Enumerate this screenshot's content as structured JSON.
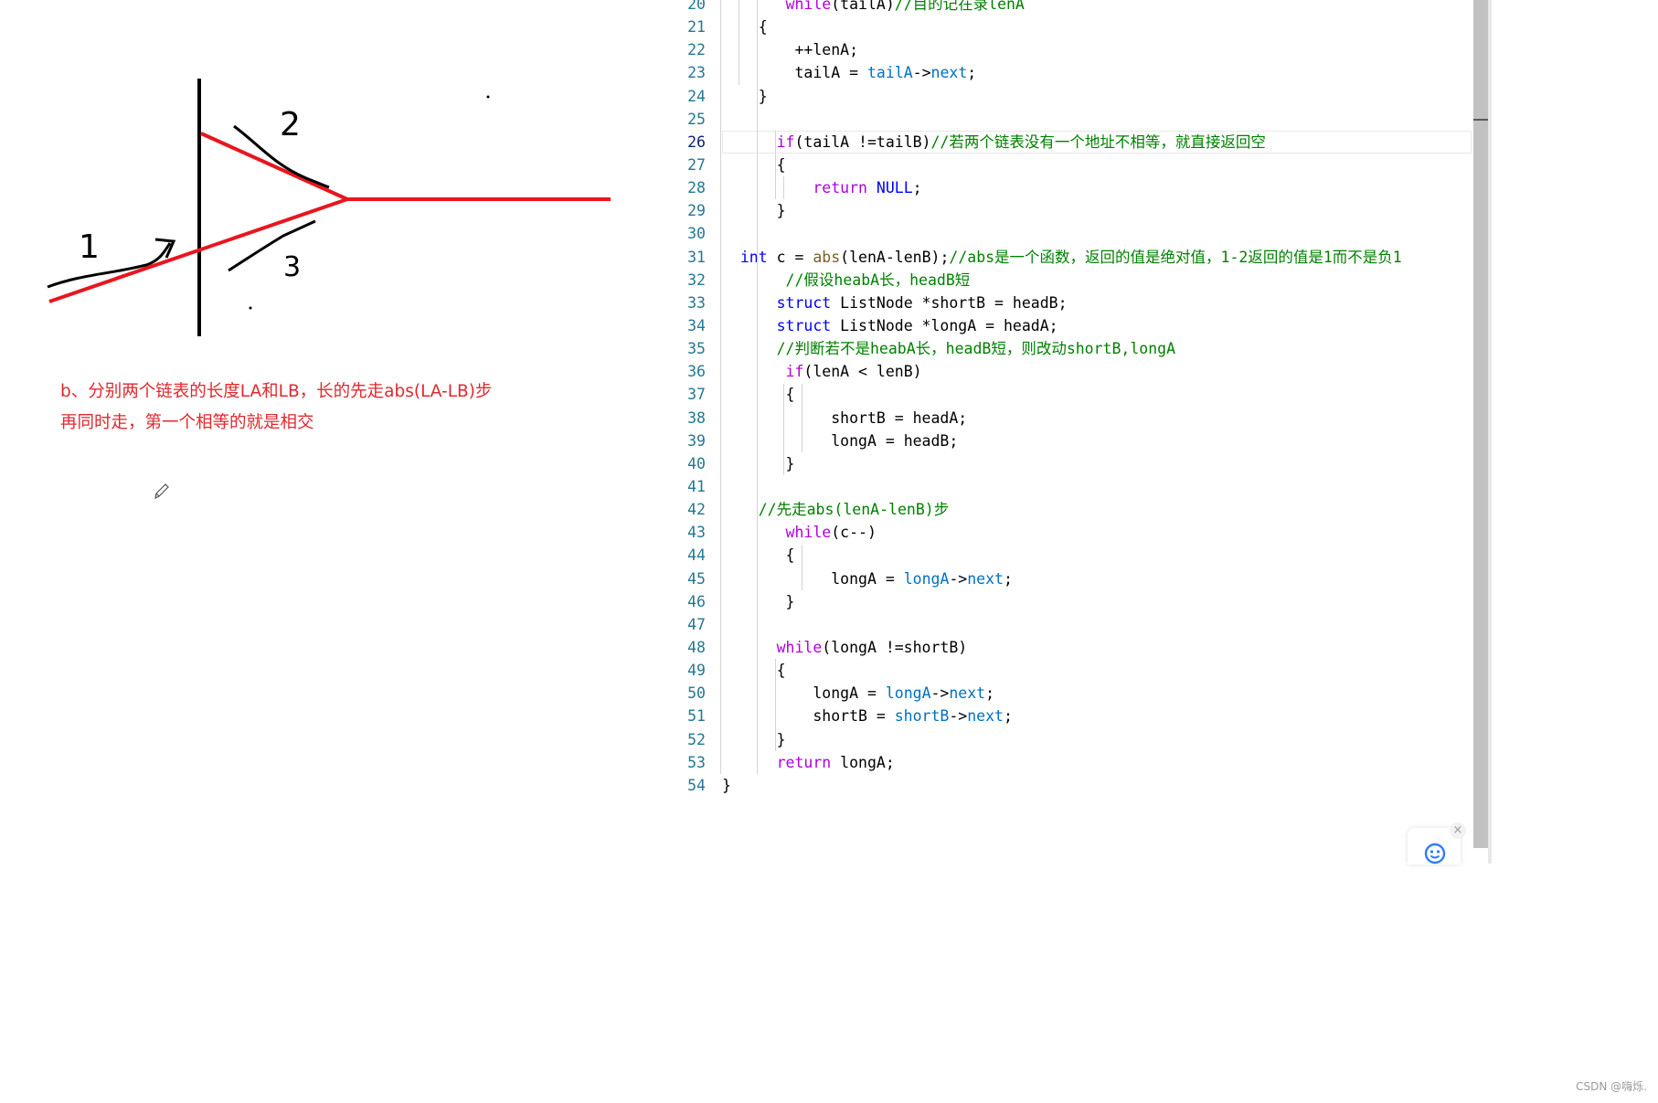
{
  "sketch": {
    "labels": [
      "1",
      "2",
      "3"
    ]
  },
  "note": {
    "line1": "b、分别两个链表的长度LA和LB，长的先走abs(LA-LB)步",
    "line2": "再同时走，第一个相等的就是相交"
  },
  "editor": {
    "current_line": 26,
    "lines": [
      {
        "n": "20",
        "indent": 7,
        "tokens": [
          [
            "ctl",
            "while"
          ],
          [
            "",
            "(tailA)"
          ],
          [
            "cm",
            "//目的记在录lenA"
          ]
        ]
      },
      {
        "n": "21",
        "indent": 4,
        "tokens": [
          [
            "",
            "{"
          ]
        ]
      },
      {
        "n": "22",
        "indent": 8,
        "tokens": [
          [
            "",
            "++lenA;"
          ]
        ]
      },
      {
        "n": "23",
        "indent": 8,
        "tokens": [
          [
            "",
            "tailA = "
          ],
          [
            "mem",
            "tailA"
          ],
          [
            "",
            "->"
          ],
          [
            "mem",
            "next"
          ],
          [
            "",
            ";"
          ]
        ]
      },
      {
        "n": "24",
        "indent": 4,
        "tokens": [
          [
            "",
            "}"
          ]
        ]
      },
      {
        "n": "25",
        "indent": 0,
        "tokens": []
      },
      {
        "n": "26",
        "indent": 6,
        "tokens": [
          [
            "ctl",
            "if"
          ],
          [
            "",
            "(tailA !=tailB)"
          ],
          [
            "cm",
            "//若两个链表没有一个地址不相等，就直接返回空"
          ]
        ]
      },
      {
        "n": "27",
        "indent": 6,
        "tokens": [
          [
            "",
            "{"
          ]
        ]
      },
      {
        "n": "28",
        "indent": 10,
        "tokens": [
          [
            "ctl",
            "return"
          ],
          [
            "",
            ""
          ],
          [
            "kw",
            " NULL"
          ],
          [
            "",
            ";"
          ]
        ]
      },
      {
        "n": "29",
        "indent": 6,
        "tokens": [
          [
            "",
            "}"
          ]
        ]
      },
      {
        "n": "30",
        "indent": 0,
        "tokens": []
      },
      {
        "n": "31",
        "indent": 2,
        "tokens": [
          [
            "kw",
            "int"
          ],
          [
            "",
            " c = "
          ],
          [
            "fn",
            "abs"
          ],
          [
            "",
            "(lenA-lenB);"
          ],
          [
            "cm",
            "//abs是一个函数，返回的值是绝对值，1-2返回的值是1而不是负1"
          ]
        ]
      },
      {
        "n": "32",
        "indent": 7,
        "tokens": [
          [
            "cm",
            "//假设heabA长，headB短"
          ]
        ]
      },
      {
        "n": "33",
        "indent": 6,
        "tokens": [
          [
            "kw",
            "struct"
          ],
          [
            "",
            " ListNode *shortB = headB;"
          ]
        ]
      },
      {
        "n": "34",
        "indent": 6,
        "tokens": [
          [
            "kw",
            "struct"
          ],
          [
            "",
            " ListNode *longA = headA;"
          ]
        ]
      },
      {
        "n": "35",
        "indent": 6,
        "tokens": [
          [
            "cm",
            "//判断若不是heabA长，headB短，则改动shortB,longA"
          ]
        ]
      },
      {
        "n": "36",
        "indent": 7,
        "tokens": [
          [
            "ctl",
            "if"
          ],
          [
            "",
            "(lenA < lenB)"
          ]
        ]
      },
      {
        "n": "37",
        "indent": 7,
        "tokens": [
          [
            "",
            "{"
          ]
        ]
      },
      {
        "n": "38",
        "indent": 12,
        "tokens": [
          [
            "",
            "shortB = headA;"
          ]
        ]
      },
      {
        "n": "39",
        "indent": 12,
        "tokens": [
          [
            "",
            "longA = headB;"
          ]
        ]
      },
      {
        "n": "40",
        "indent": 7,
        "tokens": [
          [
            "",
            "}"
          ]
        ]
      },
      {
        "n": "41",
        "indent": 0,
        "tokens": []
      },
      {
        "n": "42",
        "indent": 4,
        "tokens": [
          [
            "cm",
            "//先走abs(lenA-lenB)步"
          ]
        ]
      },
      {
        "n": "43",
        "indent": 7,
        "tokens": [
          [
            "ctl",
            "while"
          ],
          [
            "",
            "(c--)"
          ]
        ]
      },
      {
        "n": "44",
        "indent": 7,
        "tokens": [
          [
            "",
            "{"
          ]
        ]
      },
      {
        "n": "45",
        "indent": 12,
        "tokens": [
          [
            "",
            "longA = "
          ],
          [
            "mem",
            "longA"
          ],
          [
            "",
            "->"
          ],
          [
            "mem",
            "next"
          ],
          [
            "",
            ";"
          ]
        ]
      },
      {
        "n": "46",
        "indent": 7,
        "tokens": [
          [
            "",
            "}"
          ]
        ]
      },
      {
        "n": "47",
        "indent": 0,
        "tokens": []
      },
      {
        "n": "48",
        "indent": 6,
        "tokens": [
          [
            "ctl",
            "while"
          ],
          [
            "",
            "(longA !=shortB)"
          ]
        ]
      },
      {
        "n": "49",
        "indent": 6,
        "tokens": [
          [
            "",
            "{"
          ]
        ]
      },
      {
        "n": "50",
        "indent": 10,
        "tokens": [
          [
            "",
            "longA = "
          ],
          [
            "mem",
            "longA"
          ],
          [
            "",
            "->"
          ],
          [
            "mem",
            "next"
          ],
          [
            "",
            ";"
          ]
        ]
      },
      {
        "n": "51",
        "indent": 10,
        "tokens": [
          [
            "",
            "shortB = "
          ],
          [
            "mem",
            "shortB"
          ],
          [
            "",
            "->"
          ],
          [
            "mem",
            "next"
          ],
          [
            "",
            ";"
          ]
        ]
      },
      {
        "n": "52",
        "indent": 6,
        "tokens": [
          [
            "",
            "}"
          ]
        ]
      },
      {
        "n": "53",
        "indent": 6,
        "tokens": [
          [
            "ctl",
            "return"
          ],
          [
            "",
            " longA;"
          ]
        ]
      },
      {
        "n": "54",
        "indent": 0,
        "tokens": [
          [
            "",
            "}"
          ]
        ]
      }
    ]
  },
  "helper": {
    "close_label": "×",
    "icon": "chat-face-icon"
  },
  "footer": {
    "watermark": "CSDN @嗨烁."
  },
  "colors": {
    "red_path": "#e8161e",
    "note_red": "#e0282e",
    "line_number": "#237893",
    "keyword": "#0000ff",
    "control": "#af00db",
    "comment": "#008000"
  }
}
